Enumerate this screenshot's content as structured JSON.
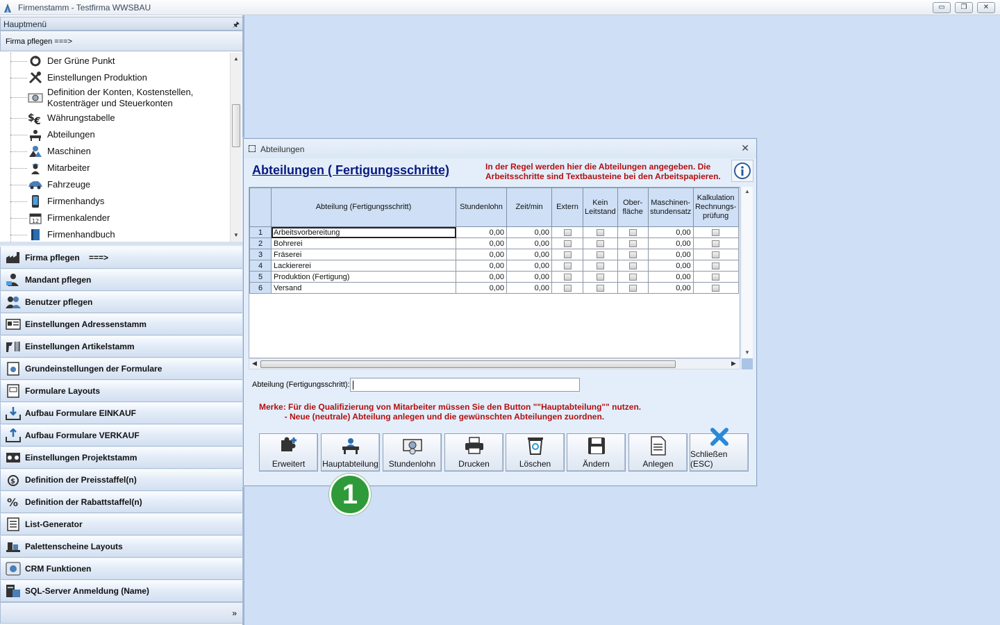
{
  "window": {
    "title": "Firmenstamm - Testfirma WWSBAU",
    "min_label": "▭",
    "restore_label": "❐",
    "close_label": "✕"
  },
  "sidebar": {
    "header": "Hauptmenü",
    "pin": "🖈",
    "section_title": "Firma pflegen    ===>",
    "tree_items": [
      {
        "label": "Der Grüne Punkt",
        "icon": "recycle-icon"
      },
      {
        "label": "Einstellungen Produktion",
        "icon": "tools-icon"
      },
      {
        "label": "Definition der Konten, Kostenstellen,\nKostenträger und Steuerkonten",
        "icon": "coins-icon"
      },
      {
        "label": "Währungstabelle",
        "icon": "currency-icon"
      },
      {
        "label": "Abteilungen",
        "icon": "department-icon"
      },
      {
        "label": "Maschinen",
        "icon": "machine-icon"
      },
      {
        "label": "Mitarbeiter",
        "icon": "employee-icon"
      },
      {
        "label": "Fahrzeuge",
        "icon": "car-icon"
      },
      {
        "label": "Firmenhandys",
        "icon": "phone-icon"
      },
      {
        "label": "Firmenkalender",
        "icon": "calendar-icon"
      },
      {
        "label": "Firmenhandbuch",
        "icon": "book-icon"
      }
    ],
    "nav_items": [
      {
        "label": "Firma pflegen    ===>",
        "icon": "factory-icon"
      },
      {
        "label": "Mandant pflegen",
        "icon": "client-icon"
      },
      {
        "label": "Benutzer pflegen",
        "icon": "users-icon"
      },
      {
        "label": "Einstellungen Adressenstamm",
        "icon": "address-card-icon"
      },
      {
        "label": "Einstellungen Artikelstamm",
        "icon": "barcode-scanner-icon"
      },
      {
        "label": "Grundeinstellungen der Formulare",
        "icon": "form-settings-icon"
      },
      {
        "label": "Formulare Layouts",
        "icon": "form-layout-icon"
      },
      {
        "label": "Aufbau Formulare EINKAUF",
        "icon": "inbox-download-icon"
      },
      {
        "label": "Aufbau Formulare VERKAUF",
        "icon": "inbox-upload-icon"
      },
      {
        "label": "Einstellungen Projektstamm",
        "icon": "project-icon"
      },
      {
        "label": "Definition der Preisstaffel(n)",
        "icon": "price-icon"
      },
      {
        "label": "Definition der Rabattstaffel(n)",
        "icon": "discount-icon"
      },
      {
        "label": "List-Generator",
        "icon": "list-icon"
      },
      {
        "label": "Palettenscheine Layouts",
        "icon": "pallet-icon"
      },
      {
        "label": "CRM Funktionen",
        "icon": "crm-icon"
      },
      {
        "label": "SQL-Server Anmeldung (Name)",
        "icon": "server-icon"
      }
    ],
    "bottom_chevron": "»"
  },
  "dialog": {
    "title": "Abteilungen",
    "close": "✕",
    "heading": "Abteilungen ( Fertigungsschritte)",
    "hint": "In der Regel werden hier die Abteilungen angegeben. Die Arbeitsschritte sind Textbausteine bei den Arbeitspapieren.",
    "columns": [
      "",
      "Abteilung (Fertigungsschritt)",
      "Stundenlohn",
      "Zeit/min",
      "Extern",
      "Kein Leitstand",
      "Ober-fläche",
      "Maschinen-stundensatz",
      "Kalkulation Rechnungs-prüfung"
    ],
    "rows": [
      {
        "nr": "1",
        "name": "Arbeitsvorbereitung",
        "stundenlohn": "0,00",
        "zeit": "0,00",
        "satz": "0,00"
      },
      {
        "nr": "2",
        "name": "Bohrerei",
        "stundenlohn": "0,00",
        "zeit": "0,00",
        "satz": "0,00"
      },
      {
        "nr": "3",
        "name": "Fräserei",
        "stundenlohn": "0,00",
        "zeit": "0,00",
        "satz": "0,00"
      },
      {
        "nr": "4",
        "name": "Lackiererei",
        "stundenlohn": "0,00",
        "zeit": "0,00",
        "satz": "0,00"
      },
      {
        "nr": "5",
        "name": "Produktion (Fertigung)",
        "stundenlohn": "0,00",
        "zeit": "0,00",
        "satz": "0,00"
      },
      {
        "nr": "6",
        "name": "Versand",
        "stundenlohn": "0,00",
        "zeit": "0,00",
        "satz": "0,00"
      }
    ],
    "field_label": "Abteilung (Fertigungsschritt):",
    "field_value": "",
    "note": "Merke: Für die Qualifizierung von Mitarbeiter müssen Sie den Button \"\"Hauptabteilung\"\" nutzen.\n           - Neue (neutrale) Abteilung anlegen und die gewünschten Abteilungen zuordnen.",
    "buttons": [
      {
        "label": "Erweitert",
        "icon": "puzzle-plus-icon"
      },
      {
        "label": "Hauptabteilung",
        "icon": "desk-person-icon"
      },
      {
        "label": "Stundenlohn",
        "icon": "money-icon"
      },
      {
        "label": "Drucken",
        "icon": "printer-icon"
      },
      {
        "label": "Löschen",
        "icon": "recycle-bin-icon"
      },
      {
        "label": "Ändern",
        "icon": "floppy-disk-icon"
      },
      {
        "label": "Anlegen",
        "icon": "new-document-icon"
      },
      {
        "label": "Schließen (ESC)",
        "icon": "close-x-icon"
      }
    ]
  },
  "callout": {
    "number": "1",
    "color": "#2f9a3a"
  }
}
